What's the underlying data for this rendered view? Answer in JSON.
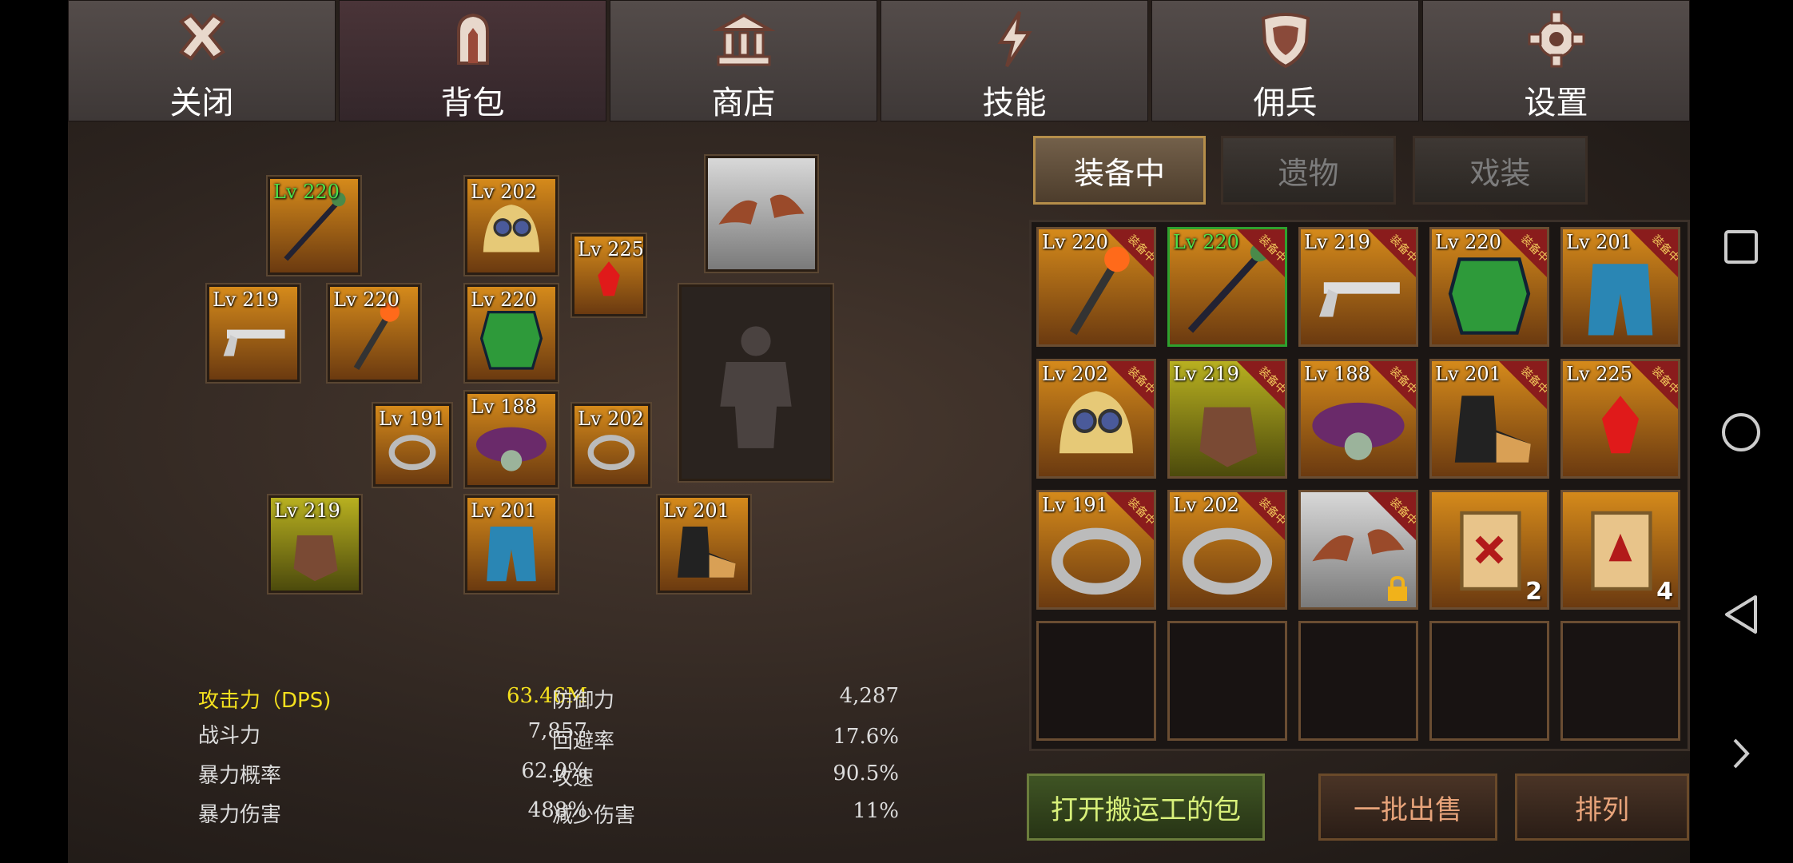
{
  "nav": [
    {
      "label": "关闭",
      "icon": "close-icon"
    },
    {
      "label": "背包",
      "icon": "backpack-icon"
    },
    {
      "label": "商店",
      "icon": "shop-icon"
    },
    {
      "label": "技能",
      "icon": "skill-icon"
    },
    {
      "label": "佣兵",
      "icon": "mercenary-icon"
    },
    {
      "label": "设置",
      "icon": "gear-icon"
    }
  ],
  "equipped": {
    "weapon_main": "Lv 220",
    "helmet": "Lv 202",
    "amulet": "Lv 225",
    "gun": "Lv 219",
    "torch": "Lv 220",
    "armor": "Lv 220",
    "ring_left": "Lv 191",
    "belt": "Lv 188",
    "ring_right": "Lv 202",
    "gloves": "Lv 219",
    "pants": "Lv 201",
    "boots": "Lv 201"
  },
  "stats": {
    "dps_label": "攻击力（DPS)",
    "dps_value": "63.46M",
    "power_label": "战斗力",
    "power_value": "7,857",
    "crit_rate_label": "暴力概率",
    "crit_rate_value": "62.0%",
    "crit_dmg_label": "暴力伤害",
    "crit_dmg_value": "488%",
    "defense_label": "防御力",
    "defense_value": "4,287",
    "evasion_label": "回避率",
    "evasion_value": "17.6%",
    "atk_speed_label": "攻速",
    "atk_speed_value": "90.5%",
    "dmg_reduce_label": "减少伤害",
    "dmg_reduce_value": "11%"
  },
  "tabs": [
    "装备中",
    "遗物",
    "戏装"
  ],
  "equipped_badge": "装备中",
  "inventory": [
    {
      "lv": "Lv 220",
      "item": "torch"
    },
    {
      "lv": "Lv 220",
      "item": "staff"
    },
    {
      "lv": "Lv 219",
      "item": "gun"
    },
    {
      "lv": "Lv 220",
      "item": "armor"
    },
    {
      "lv": "Lv 201",
      "item": "pants"
    },
    {
      "lv": "Lv 202",
      "item": "helmet"
    },
    {
      "lv": "Lv 219",
      "item": "gloves"
    },
    {
      "lv": "Lv 188",
      "item": "belt"
    },
    {
      "lv": "Lv 201",
      "item": "boots"
    },
    {
      "lv": "Lv 225",
      "item": "amulet"
    },
    {
      "lv": "Lv 191",
      "item": "ring"
    },
    {
      "lv": "Lv 202",
      "item": "ring"
    },
    {
      "lv": "",
      "item": "wings"
    },
    {
      "lv": "",
      "item": "scroll",
      "count": "2"
    },
    {
      "lv": "",
      "item": "scroll",
      "count": "4"
    }
  ],
  "buttons": {
    "porter": "打开搬运工的包",
    "bulk_sell": "一批出售",
    "sort": "排列"
  },
  "colors": {
    "accent_green": "#4be14b",
    "yellow": "#f4e01e",
    "badge_red": "#8a1c1c"
  }
}
